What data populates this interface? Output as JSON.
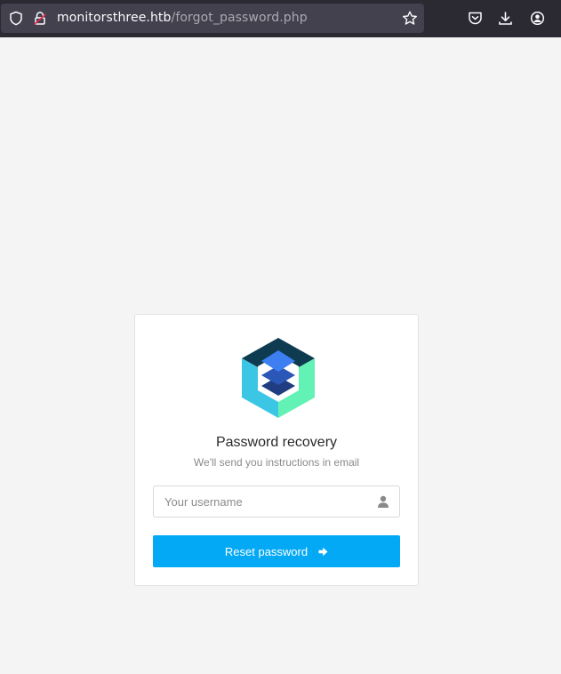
{
  "browser": {
    "url_host": "monitorsthree.htb",
    "url_path": "/forgot_password.php",
    "icons": [
      "shield-icon",
      "lock-icon",
      "star-icon",
      "pocket-icon",
      "download-icon",
      "account-icon"
    ]
  },
  "card": {
    "logo_icon": "hexagon-layers-logo",
    "title": "Password recovery",
    "subtitle": "We'll send you instructions in email",
    "username_placeholder": "Your username",
    "username_value": "",
    "submit_label": "Reset password"
  },
  "colors": {
    "page_bg": "#f4f4f4",
    "button": "#03a9f4",
    "chrome": "#2b2a33",
    "urlbar": "#42414d"
  }
}
